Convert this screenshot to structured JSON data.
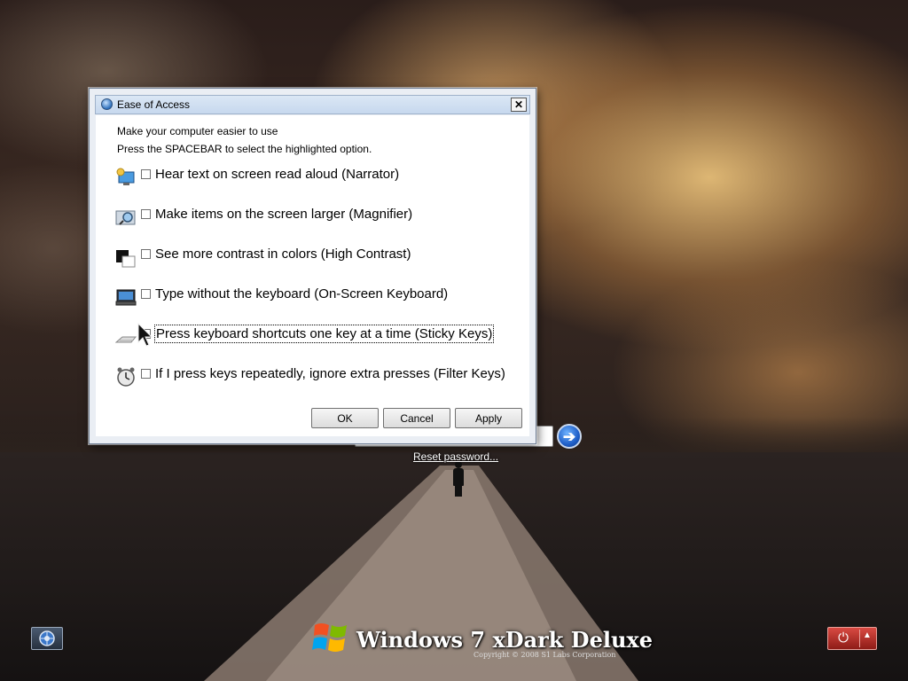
{
  "dialog": {
    "title": "Ease of Access",
    "close_label": "✕",
    "heading": "Make your computer easier to use",
    "instruction": "Press the SPACEBAR to select the highlighted option.",
    "options": [
      {
        "label": "Hear text on screen read aloud (Narrator)",
        "icon": "narrator-icon",
        "checked": false
      },
      {
        "label": "Make items on the screen larger (Magnifier)",
        "icon": "magnifier-icon",
        "checked": false
      },
      {
        "label": "See more contrast in colors (High Contrast)",
        "icon": "high-contrast-icon",
        "checked": false
      },
      {
        "label": "Type without the keyboard (On-Screen Keyboard)",
        "icon": "on-screen-keyboard-icon",
        "checked": false
      },
      {
        "label": "Press keyboard shortcuts one key at a time (Sticky Keys)",
        "icon": "sticky-keys-icon",
        "checked": false
      },
      {
        "label": "If I press keys repeatedly, ignore extra presses (Filter Keys)",
        "icon": "filter-keys-icon",
        "checked": false
      }
    ],
    "buttons": {
      "ok": "OK",
      "cancel": "Cancel",
      "apply": "Apply"
    }
  },
  "login": {
    "submit_icon": "arrow-right-icon",
    "submit_glyph": "➔",
    "reset_password": "Reset password..."
  },
  "taskbar": {
    "ease_icon": "ease-of-access-icon",
    "power_glyph": "⏻",
    "power_menu_glyph": "▲"
  },
  "branding": {
    "name": "Windows 7 xDark Deluxe",
    "copyright": "Copyright © 2008 S1 Labs Corporation"
  },
  "colors": {
    "dialog_frame": "#eaeef4",
    "power_button": "#c0342c",
    "submit_button": "#1f5fc8"
  }
}
